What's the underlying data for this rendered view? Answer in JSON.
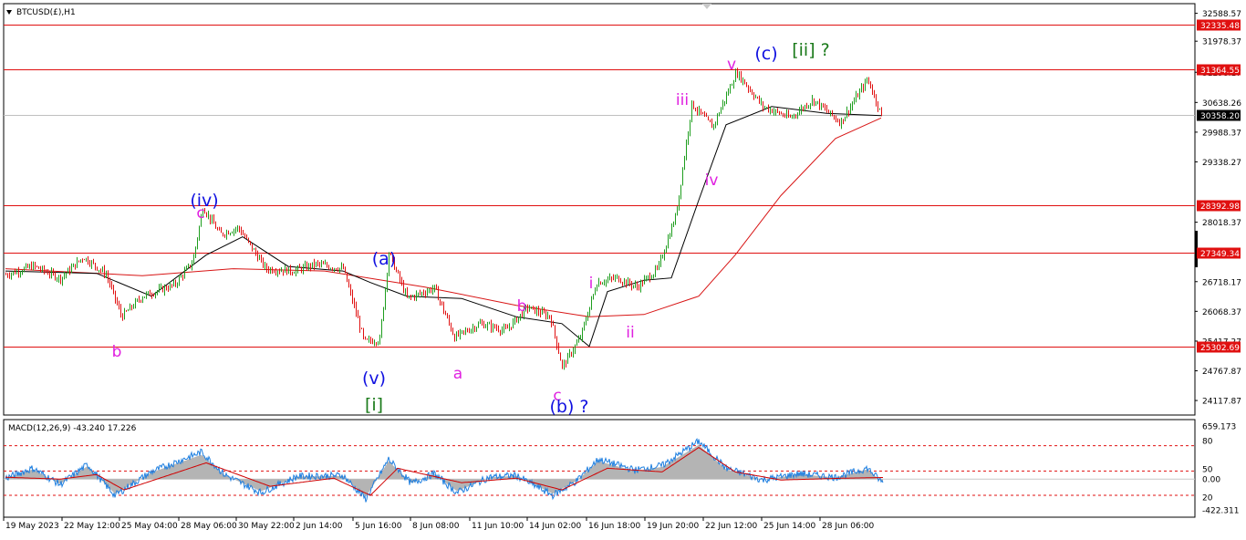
{
  "window": {
    "symbol_label": "BTCUSD(£),H1",
    "menu_icon": "triangle-down-icon"
  },
  "colors": {
    "background": "#ffffff",
    "bull_candle": "#1e9e1e",
    "bear_candle": "#e01010",
    "level_line": "#e01010",
    "ma_fast": "#000000",
    "ma_slow": "#d81515",
    "macd_line": "#1e7fe0",
    "macd_signal": "#d00000",
    "macd_hist": "#b4b4b4",
    "price_tag_red": "#e01010",
    "price_tag_current": "#000000",
    "wave_blue": "#1010e0",
    "wave_green": "#1a7a1a",
    "wave_magenta": "#e020e0"
  },
  "chart_data": [
    {
      "type": "candlestick",
      "title": "BTCUSD(£),H1",
      "ylim": [
        23800,
        32800
      ],
      "y_ticks": [
        "32588.57",
        "31978.37",
        "31298.17",
        "30638.26",
        "29988.37",
        "29338.27",
        "28018.37",
        "26718.17",
        "26068.37",
        "25417.27",
        "24767.87",
        "24117.87"
      ],
      "x_ticks": [
        "19 May 2023",
        "22 May 12:00",
        "25 May 04:00",
        "28 May 06:00",
        "30 May 22:00",
        "2 Jun 14:00",
        "5 Jun 16:00",
        "8 Jun 08:00",
        "11 Jun 10:00",
        "14 Jun 02:00",
        "16 Jun 18:00",
        "19 Jun 20:00",
        "22 Jun 12:00",
        "25 Jun 14:00",
        "28 Jun 06:00"
      ],
      "horizontal_levels": [
        "32335.48",
        "31364.55",
        "28392.98",
        "27349.34",
        "25302.69"
      ],
      "current_price": "30358.20",
      "grid": false,
      "price_path": [
        {
          "x": 0,
          "y": 26870
        },
        {
          "x": 30,
          "y": 27060
        },
        {
          "x": 60,
          "y": 26790
        },
        {
          "x": 85,
          "y": 27260
        },
        {
          "x": 110,
          "y": 26880
        },
        {
          "x": 127,
          "y": 25950
        },
        {
          "x": 150,
          "y": 26400
        },
        {
          "x": 185,
          "y": 26650
        },
        {
          "x": 205,
          "y": 27150
        },
        {
          "x": 216,
          "y": 28350
        },
        {
          "x": 235,
          "y": 27750
        },
        {
          "x": 255,
          "y": 27900
        },
        {
          "x": 285,
          "y": 27000
        },
        {
          "x": 315,
          "y": 26950
        },
        {
          "x": 340,
          "y": 27100
        },
        {
          "x": 370,
          "y": 27000
        },
        {
          "x": 393,
          "y": 25400
        },
        {
          "x": 410,
          "y": 25450
        },
        {
          "x": 420,
          "y": 27350
        },
        {
          "x": 440,
          "y": 26350
        },
        {
          "x": 470,
          "y": 26580
        },
        {
          "x": 492,
          "y": 25500
        },
        {
          "x": 520,
          "y": 25800
        },
        {
          "x": 548,
          "y": 25650
        },
        {
          "x": 572,
          "y": 26150
        },
        {
          "x": 597,
          "y": 25950
        },
        {
          "x": 610,
          "y": 24850
        },
        {
          "x": 630,
          "y": 25500
        },
        {
          "x": 648,
          "y": 26700
        },
        {
          "x": 670,
          "y": 26800
        },
        {
          "x": 692,
          "y": 26600
        },
        {
          "x": 715,
          "y": 27000
        },
        {
          "x": 735,
          "y": 28200
        },
        {
          "x": 752,
          "y": 30600
        },
        {
          "x": 775,
          "y": 30100
        },
        {
          "x": 801,
          "y": 31300
        },
        {
          "x": 830,
          "y": 30550
        },
        {
          "x": 860,
          "y": 30300
        },
        {
          "x": 885,
          "y": 30700
        },
        {
          "x": 915,
          "y": 30200
        },
        {
          "x": 945,
          "y": 31150
        },
        {
          "x": 960,
          "y": 30358
        }
      ],
      "ma_fast": [
        {
          "x": 0,
          "y": 26950
        },
        {
          "x": 100,
          "y": 26900
        },
        {
          "x": 160,
          "y": 26400
        },
        {
          "x": 220,
          "y": 27300
        },
        {
          "x": 260,
          "y": 27700
        },
        {
          "x": 310,
          "y": 27050
        },
        {
          "x": 370,
          "y": 26950
        },
        {
          "x": 400,
          "y": 26700
        },
        {
          "x": 440,
          "y": 26400
        },
        {
          "x": 500,
          "y": 26350
        },
        {
          "x": 560,
          "y": 25950
        },
        {
          "x": 610,
          "y": 25800
        },
        {
          "x": 640,
          "y": 25300
        },
        {
          "x": 660,
          "y": 26500
        },
        {
          "x": 700,
          "y": 26750
        },
        {
          "x": 730,
          "y": 26800
        },
        {
          "x": 760,
          "y": 28500
        },
        {
          "x": 790,
          "y": 30150
        },
        {
          "x": 840,
          "y": 30550
        },
        {
          "x": 900,
          "y": 30400
        },
        {
          "x": 960,
          "y": 30350
        }
      ],
      "ma_slow": [
        {
          "x": 0,
          "y": 27000
        },
        {
          "x": 150,
          "y": 26850
        },
        {
          "x": 250,
          "y": 27000
        },
        {
          "x": 350,
          "y": 26950
        },
        {
          "x": 460,
          "y": 26600
        },
        {
          "x": 560,
          "y": 26200
        },
        {
          "x": 640,
          "y": 25950
        },
        {
          "x": 700,
          "y": 26000
        },
        {
          "x": 760,
          "y": 26400
        },
        {
          "x": 800,
          "y": 27300
        },
        {
          "x": 850,
          "y": 28600
        },
        {
          "x": 910,
          "y": 29850
        },
        {
          "x": 960,
          "y": 30300
        }
      ]
    },
    {
      "type": "line",
      "title": "MACD(12,26,9) -43.240 17.226",
      "ylim": [
        -422.311,
        659.173
      ],
      "y_ticks": [
        "659.173",
        "80",
        "50",
        "0.00",
        "20",
        "-422.311"
      ],
      "macd_line": [
        {
          "x": 0,
          "y": 10
        },
        {
          "x": 30,
          "y": 120
        },
        {
          "x": 60,
          "y": -60
        },
        {
          "x": 90,
          "y": 160
        },
        {
          "x": 120,
          "y": -180
        },
        {
          "x": 160,
          "y": 80
        },
        {
          "x": 215,
          "y": 300
        },
        {
          "x": 240,
          "y": 50
        },
        {
          "x": 280,
          "y": -150
        },
        {
          "x": 320,
          "y": 30
        },
        {
          "x": 370,
          "y": 40
        },
        {
          "x": 395,
          "y": -220
        },
        {
          "x": 420,
          "y": 220
        },
        {
          "x": 445,
          "y": -50
        },
        {
          "x": 470,
          "y": 60
        },
        {
          "x": 495,
          "y": -150
        },
        {
          "x": 530,
          "y": 20
        },
        {
          "x": 560,
          "y": 40
        },
        {
          "x": 600,
          "y": -180
        },
        {
          "x": 625,
          "y": -30
        },
        {
          "x": 650,
          "y": 220
        },
        {
          "x": 690,
          "y": 100
        },
        {
          "x": 720,
          "y": 150
        },
        {
          "x": 760,
          "y": 420
        },
        {
          "x": 790,
          "y": 120
        },
        {
          "x": 830,
          "y": -10
        },
        {
          "x": 870,
          "y": 60
        },
        {
          "x": 910,
          "y": 20
        },
        {
          "x": 945,
          "y": 120
        },
        {
          "x": 962,
          "y": -43.24
        }
      ],
      "signal_line": [
        {
          "x": 0,
          "y": 20
        },
        {
          "x": 60,
          "y": 0
        },
        {
          "x": 100,
          "y": 50
        },
        {
          "x": 130,
          "y": -120
        },
        {
          "x": 220,
          "y": 180
        },
        {
          "x": 290,
          "y": -80
        },
        {
          "x": 360,
          "y": 10
        },
        {
          "x": 400,
          "y": -180
        },
        {
          "x": 430,
          "y": 120
        },
        {
          "x": 500,
          "y": -40
        },
        {
          "x": 560,
          "y": 10
        },
        {
          "x": 610,
          "y": -120
        },
        {
          "x": 660,
          "y": 120
        },
        {
          "x": 720,
          "y": 80
        },
        {
          "x": 760,
          "y": 350
        },
        {
          "x": 800,
          "y": 80
        },
        {
          "x": 850,
          "y": -10
        },
        {
          "x": 920,
          "y": 10
        },
        {
          "x": 962,
          "y": 17.226
        }
      ]
    }
  ],
  "wave_labels": [
    {
      "text": "(iv)",
      "color": "blue"
    },
    {
      "text": "c",
      "color": "magenta"
    },
    {
      "text": "b",
      "color": "magenta"
    },
    {
      "text": "(a)",
      "color": "blue"
    },
    {
      "text": "(v)",
      "color": "blue"
    },
    {
      "text": "[i]",
      "color": "green"
    },
    {
      "text": "a",
      "color": "magenta"
    },
    {
      "text": "b",
      "color": "magenta"
    },
    {
      "text": "c",
      "color": "magenta"
    },
    {
      "text": "(b) ?",
      "color": "blue"
    },
    {
      "text": "i",
      "color": "magenta"
    },
    {
      "text": "ii",
      "color": "magenta"
    },
    {
      "text": "iii",
      "color": "magenta"
    },
    {
      "text": "iv",
      "color": "magenta"
    },
    {
      "text": "v",
      "color": "magenta"
    },
    {
      "text": "(c)",
      "color": "blue"
    },
    {
      "text": "[ii] ?",
      "color": "green"
    }
  ]
}
